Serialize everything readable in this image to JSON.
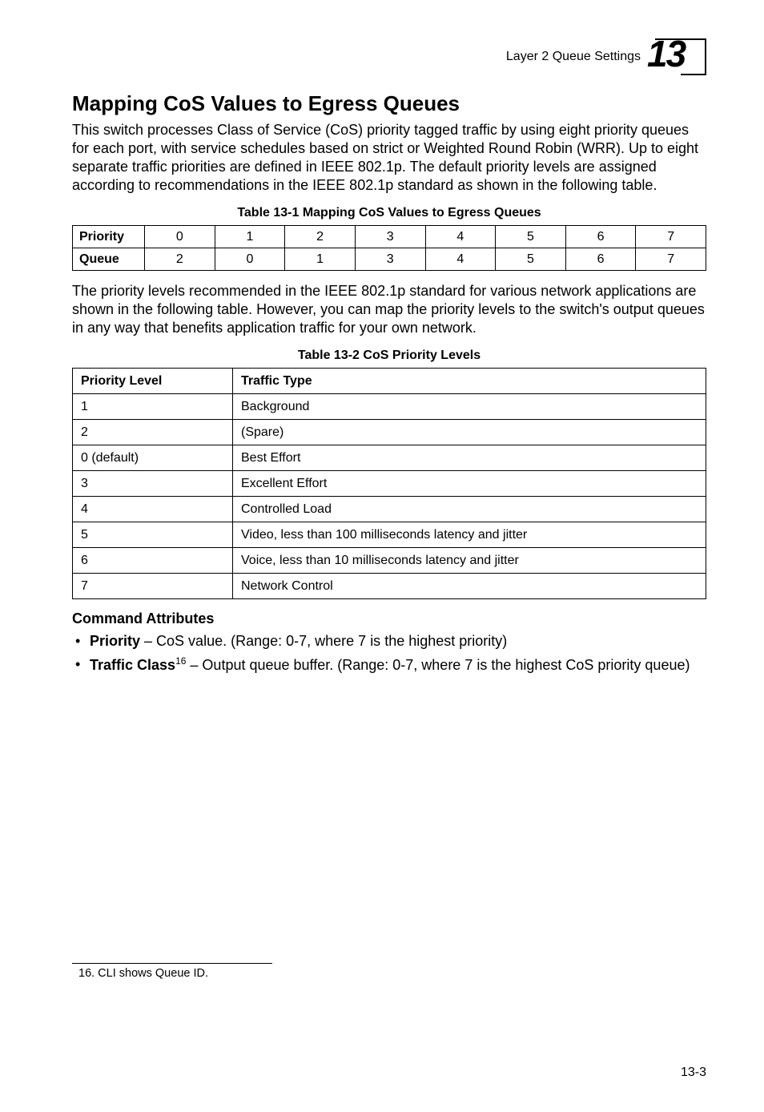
{
  "header": {
    "running": "Layer 2 Queue Settings",
    "chapter": "13"
  },
  "section_title": "Mapping CoS Values to Egress Queues",
  "intro": "This switch processes Class of Service (CoS) priority tagged traffic by using eight priority queues for each port, with service schedules based on strict or Weighted Round Robin (WRR). Up to eight separate traffic priorities are defined in IEEE 802.1p. The default priority levels are assigned according to recommendations in the IEEE 802.1p standard as shown in the following table.",
  "table1": {
    "caption": "Table 13-1   Mapping CoS Values to Egress Queues",
    "row_labels": [
      "Priority",
      "Queue"
    ],
    "priority": [
      "0",
      "1",
      "2",
      "3",
      "4",
      "5",
      "6",
      "7"
    ],
    "queue": [
      "2",
      "0",
      "1",
      "3",
      "4",
      "5",
      "6",
      "7"
    ]
  },
  "para2": "The priority levels recommended in the IEEE 802.1p standard for various network applications are shown in the following table. However, you can map the priority levels to the switch's output queues in any way that benefits application traffic for your own network.",
  "table2": {
    "caption": "Table 13-2   CoS Priority Levels",
    "headers": [
      "Priority Level",
      "Traffic Type"
    ],
    "rows": [
      [
        "1",
        "Background"
      ],
      [
        "2",
        "(Spare)"
      ],
      [
        "0 (default)",
        "Best Effort"
      ],
      [
        "3",
        "Excellent Effort"
      ],
      [
        "4",
        "Controlled Load"
      ],
      [
        "5",
        "Video, less than 100 milliseconds latency and jitter"
      ],
      [
        "6",
        "Voice, less than 10 milliseconds latency and jitter"
      ],
      [
        "7",
        "Network Control"
      ]
    ]
  },
  "cmd_attrs_heading": "Command Attributes",
  "attrs": {
    "a1_label": "Priority",
    "a1_text": " – CoS value. (Range: 0-7, where 7 is the highest priority)",
    "a2_label": "Traffic Class",
    "a2_sup": "16",
    "a2_text": " – Output queue buffer. (Range: 0-7, where 7 is the highest CoS priority queue)"
  },
  "footnote": "16.  CLI shows Queue ID.",
  "page_number": "13-3"
}
